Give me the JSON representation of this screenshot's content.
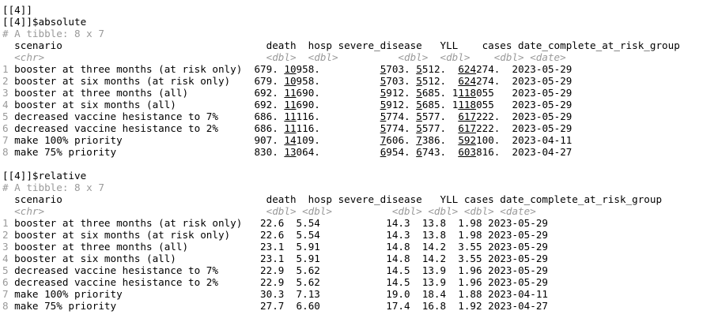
{
  "console": {
    "lines": [
      {
        "kind": "plain",
        "text": "[[4]]"
      },
      {
        "kind": "plain",
        "text": "[[4]]$absolute"
      },
      {
        "kind": "comment",
        "text": "# A tibble: 8 x 7"
      },
      {
        "kind": "header",
        "text": "  scenario                                  death  hosp severe_disease   YLL    cases date_complete_at_risk_group"
      },
      {
        "kind": "types",
        "text": "  <chr>                                     <dbl>  <dbl>          <dbl>  <dbl>    <dbl> <date>"
      },
      {
        "kind": "row",
        "n": "1",
        "segs": [
          " booster at three months (at risk only)  679. ",
          {
            "u": "10"
          },
          "958.          ",
          {
            "u": "5"
          },
          "703. ",
          {
            "u": "5"
          },
          "512.  ",
          {
            "u": "624"
          },
          "274.  2023-05-29"
        ]
      },
      {
        "kind": "row",
        "n": "2",
        "segs": [
          " booster at six months (at risk only)    679. ",
          {
            "u": "10"
          },
          "958.          ",
          {
            "u": "5"
          },
          "703. ",
          {
            "u": "5"
          },
          "512.  ",
          {
            "u": "624"
          },
          "274.  2023-05-29"
        ]
      },
      {
        "kind": "row",
        "n": "3",
        "segs": [
          " booster at three months (all)           692. ",
          {
            "u": "11"
          },
          "690.          ",
          {
            "u": "5"
          },
          "912. ",
          {
            "u": "5"
          },
          "685. 1",
          {
            "u": "118"
          },
          "055   2023-05-29"
        ]
      },
      {
        "kind": "row",
        "n": "4",
        "segs": [
          " booster at six months (all)             692. ",
          {
            "u": "11"
          },
          "690.          ",
          {
            "u": "5"
          },
          "912. ",
          {
            "u": "5"
          },
          "685. 1",
          {
            "u": "118"
          },
          "055   2023-05-29"
        ]
      },
      {
        "kind": "row",
        "n": "5",
        "segs": [
          " decreased vaccine hesistance to 7%      686. ",
          {
            "u": "11"
          },
          "116.          ",
          {
            "u": "5"
          },
          "774. ",
          {
            "u": "5"
          },
          "577.  ",
          {
            "u": "617"
          },
          "222.  2023-05-29"
        ]
      },
      {
        "kind": "row",
        "n": "6",
        "segs": [
          " decreased vaccine hesistance to 2%      686. ",
          {
            "u": "11"
          },
          "116.          ",
          {
            "u": "5"
          },
          "774. ",
          {
            "u": "5"
          },
          "577.  ",
          {
            "u": "617"
          },
          "222.  2023-05-29"
        ]
      },
      {
        "kind": "row",
        "n": "7",
        "segs": [
          " make 100% priority                      907. ",
          {
            "u": "14"
          },
          "109.          ",
          {
            "u": "7"
          },
          "606. ",
          {
            "u": "7"
          },
          "386.  ",
          {
            "u": "592"
          },
          "100.  2023-04-11"
        ]
      },
      {
        "kind": "row",
        "n": "8",
        "segs": [
          " make 75% priority                       830. ",
          {
            "u": "13"
          },
          "064.          ",
          {
            "u": "6"
          },
          "954. ",
          {
            "u": "6"
          },
          "743.  ",
          {
            "u": "603"
          },
          "816.  2023-04-27"
        ]
      },
      {
        "kind": "plain",
        "text": ""
      },
      {
        "kind": "plain",
        "text": "[[4]]$relative"
      },
      {
        "kind": "comment",
        "text": "# A tibble: 8 x 7"
      },
      {
        "kind": "header",
        "text": "  scenario                                  death  hosp severe_disease   YLL cases date_complete_at_risk_group"
      },
      {
        "kind": "types",
        "text": "  <chr>                                     <dbl> <dbl>          <dbl> <dbl> <dbl> <date>"
      },
      {
        "kind": "row",
        "n": "1",
        "segs": [
          " booster at three months (at risk only)   22.6  5.54           14.3  13.8  1.98 2023-05-29"
        ]
      },
      {
        "kind": "row",
        "n": "2",
        "segs": [
          " booster at six months (at risk only)     22.6  5.54           14.3  13.8  1.98 2023-05-29"
        ]
      },
      {
        "kind": "row",
        "n": "3",
        "segs": [
          " booster at three months (all)            23.1  5.91           14.8  14.2  3.55 2023-05-29"
        ]
      },
      {
        "kind": "row",
        "n": "4",
        "segs": [
          " booster at six months (all)              23.1  5.91           14.8  14.2  3.55 2023-05-29"
        ]
      },
      {
        "kind": "row",
        "n": "5",
        "segs": [
          " decreased vaccine hesistance to 7%       22.9  5.62           14.5  13.9  1.96 2023-05-29"
        ]
      },
      {
        "kind": "row",
        "n": "6",
        "segs": [
          " decreased vaccine hesistance to 2%       22.9  5.62           14.5  13.9  1.96 2023-05-29"
        ]
      },
      {
        "kind": "row",
        "n": "7",
        "segs": [
          " make 100% priority                       30.3  7.13           19.0  18.4  1.88 2023-04-11"
        ]
      },
      {
        "kind": "row",
        "n": "8",
        "segs": [
          " make 75% priority                        27.7  6.60           17.4  16.8  1.92 2023-04-27"
        ]
      }
    ]
  }
}
